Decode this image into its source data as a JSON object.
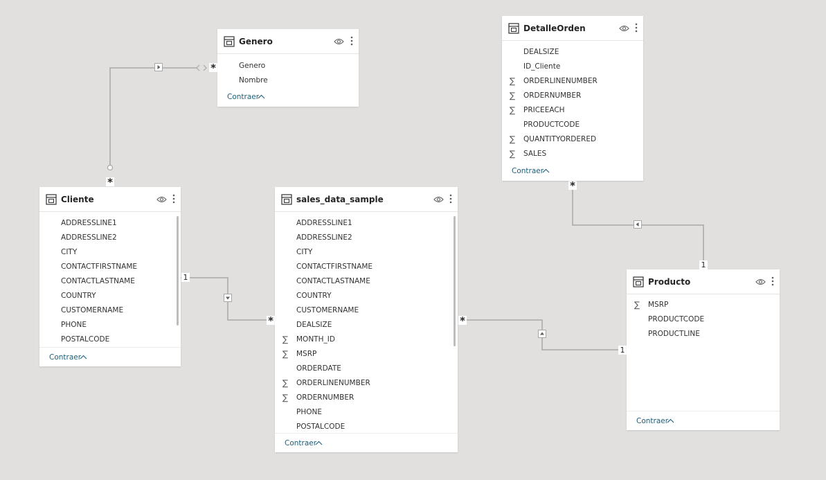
{
  "tables": {
    "genero": {
      "name": "Genero",
      "fields": [
        {
          "label": "Genero",
          "sigma": ""
        },
        {
          "label": "Nombre",
          "sigma": ""
        }
      ],
      "collapse": "Contraer"
    },
    "detalle": {
      "name": "DetalleOrden",
      "fields": [
        {
          "label": "DEALSIZE",
          "sigma": ""
        },
        {
          "label": "ID_Cliente",
          "sigma": ""
        },
        {
          "label": "ORDERLINENUMBER",
          "sigma": "∑"
        },
        {
          "label": "ORDERNUMBER",
          "sigma": "∑"
        },
        {
          "label": "PRICEEACH",
          "sigma": "∑"
        },
        {
          "label": "PRODUCTCODE",
          "sigma": ""
        },
        {
          "label": "QUANTITYORDERED",
          "sigma": "∑"
        },
        {
          "label": "SALES",
          "sigma": "∑"
        }
      ],
      "collapse": "Contraer"
    },
    "cliente": {
      "name": "Cliente",
      "fields": [
        {
          "label": "ADDRESSLINE1",
          "sigma": ""
        },
        {
          "label": "ADDRESSLINE2",
          "sigma": ""
        },
        {
          "label": "CITY",
          "sigma": ""
        },
        {
          "label": "CONTACTFIRSTNAME",
          "sigma": ""
        },
        {
          "label": "CONTACTLASTNAME",
          "sigma": ""
        },
        {
          "label": "COUNTRY",
          "sigma": ""
        },
        {
          "label": "CUSTOMERNAME",
          "sigma": ""
        },
        {
          "label": "PHONE",
          "sigma": ""
        },
        {
          "label": "POSTALCODE",
          "sigma": ""
        }
      ],
      "collapse": "Contraer"
    },
    "sales": {
      "name": "sales_data_sample",
      "fields": [
        {
          "label": "ADDRESSLINE1",
          "sigma": ""
        },
        {
          "label": "ADDRESSLINE2",
          "sigma": ""
        },
        {
          "label": "CITY",
          "sigma": ""
        },
        {
          "label": "CONTACTFIRSTNAME",
          "sigma": ""
        },
        {
          "label": "CONTACTLASTNAME",
          "sigma": ""
        },
        {
          "label": "COUNTRY",
          "sigma": ""
        },
        {
          "label": "CUSTOMERNAME",
          "sigma": ""
        },
        {
          "label": "DEALSIZE",
          "sigma": ""
        },
        {
          "label": "MONTH_ID",
          "sigma": "∑"
        },
        {
          "label": "MSRP",
          "sigma": "∑"
        },
        {
          "label": "ORDERDATE",
          "sigma": ""
        },
        {
          "label": "ORDERLINENUMBER",
          "sigma": "∑"
        },
        {
          "label": "ORDERNUMBER",
          "sigma": "∑"
        },
        {
          "label": "PHONE",
          "sigma": ""
        },
        {
          "label": "POSTALCODE",
          "sigma": ""
        }
      ],
      "collapse": "Contraer"
    },
    "producto": {
      "name": "Producto",
      "fields": [
        {
          "label": "MSRP",
          "sigma": "∑"
        },
        {
          "label": "PRODUCTCODE",
          "sigma": ""
        },
        {
          "label": "PRODUCTLINE",
          "sigma": ""
        }
      ],
      "collapse": "Contraer"
    }
  },
  "relationships": {
    "cliente_genero": {
      "from_card": "*",
      "to_card": "*"
    },
    "cliente_sales": {
      "from_card": "1",
      "to_card": "*"
    },
    "sales_producto": {
      "from_card": "*",
      "to_card": "1"
    },
    "detalle_producto": {
      "from_card": "*",
      "to_card": "1"
    }
  },
  "colors": {
    "canvas": "#e1e0df",
    "card": "#ffffff",
    "line": "#a7a7a7",
    "link_text": "#1b5e79"
  }
}
